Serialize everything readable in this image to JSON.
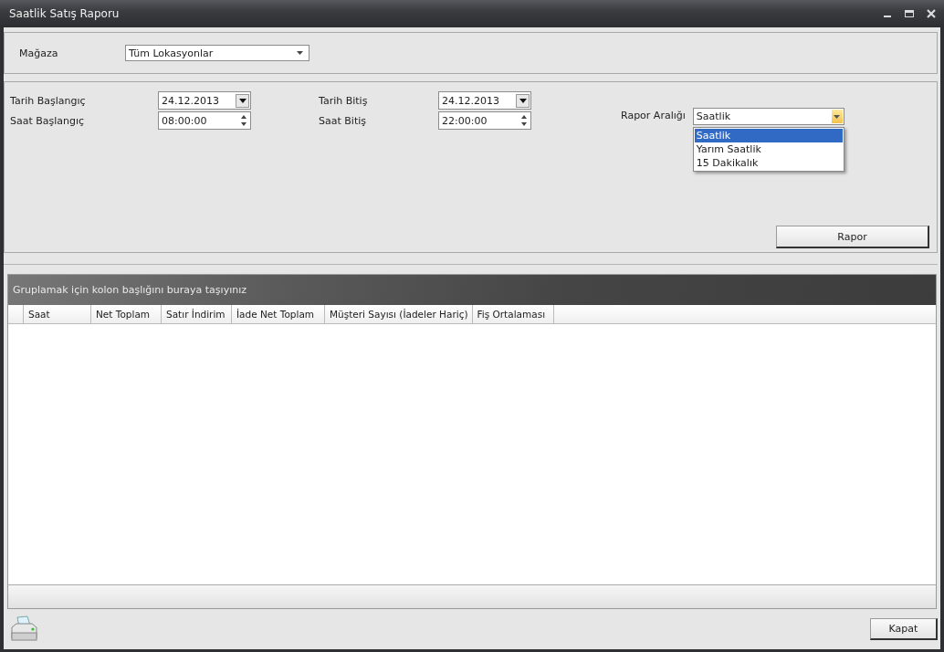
{
  "window": {
    "title": "Saatlik Satış Raporu"
  },
  "store": {
    "label": "Mağaza",
    "value": "Tüm Lokasyonlar"
  },
  "start_date": {
    "label": "Tarih Başlangıç",
    "value": "24.12.2013"
  },
  "start_time": {
    "label": "Saat Başlangıç",
    "value": "08:00:00"
  },
  "end_date": {
    "label": "Tarih Bitiş",
    "value": "24.12.2013"
  },
  "end_time": {
    "label": "Saat Bitiş",
    "value": "22:00:00"
  },
  "report_interval": {
    "label": "Rapor Aralığı",
    "value": "Saatlik",
    "expanded": true,
    "options": [
      {
        "label": "Saatlik",
        "selected": true
      },
      {
        "label": "Yarım Saatlik",
        "selected": false
      },
      {
        "label": "15 Dakikalık",
        "selected": false
      }
    ]
  },
  "report_button": "Rapor",
  "grid": {
    "group_hint": "Gruplamak için kolon başlığını buraya taşıyınız",
    "columns": [
      {
        "label": "Saat"
      },
      {
        "label": "Net Toplam"
      },
      {
        "label": "Satır İndirim"
      },
      {
        "label": "İade Net Toplam"
      },
      {
        "label": "Müşteri Sayısı (İadeler Hariç)"
      },
      {
        "label": "Fiş Ortalaması"
      }
    ]
  },
  "close_button": "Kapat"
}
